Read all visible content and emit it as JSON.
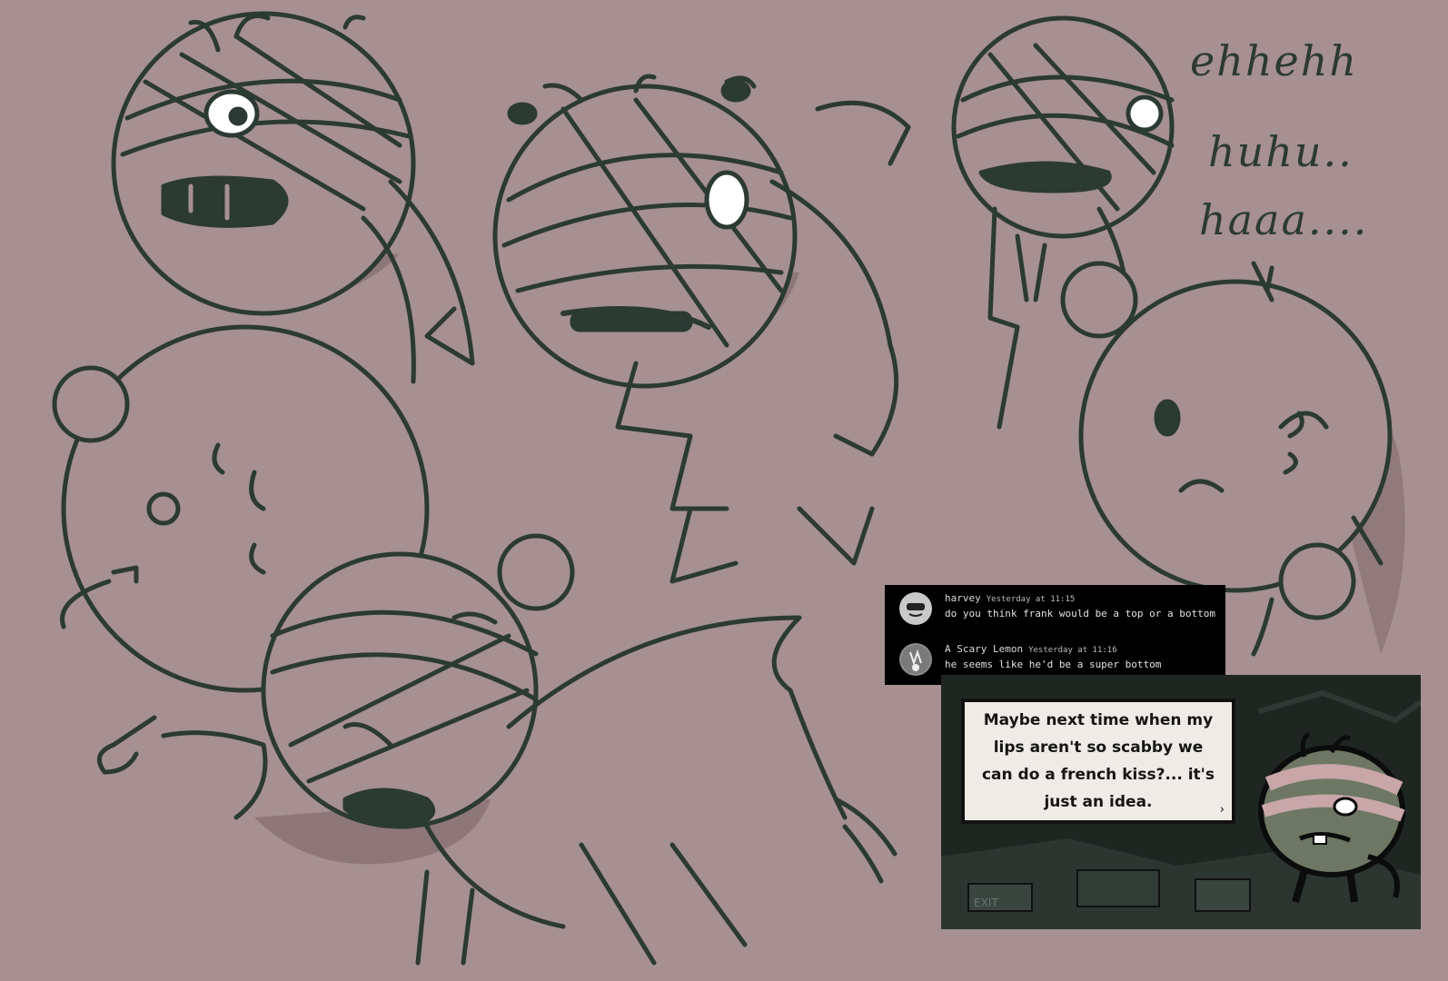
{
  "laugh_text": {
    "line1": "ehhehh",
    "line2": "huhu..",
    "line3": "haaa...."
  },
  "chat": {
    "messages": [
      {
        "author": "harvey",
        "time": "Yesterday at 11:15",
        "text": "do you think frank would be a top or a bottom"
      },
      {
        "author": "A Scary Lemon",
        "time": "Yesterday at 11:16",
        "text": "he seems like he'd be a super bottom"
      }
    ]
  },
  "game": {
    "dialogue": "Maybe next time when my lips aren't so scabby we can do a french kiss?... it's just an idea.",
    "advance_glyph": "›",
    "exit_sign": "EXIT"
  },
  "colors": {
    "background": "#a69091",
    "line_ink": "#2b3a33",
    "shadow": "#7a6365"
  }
}
